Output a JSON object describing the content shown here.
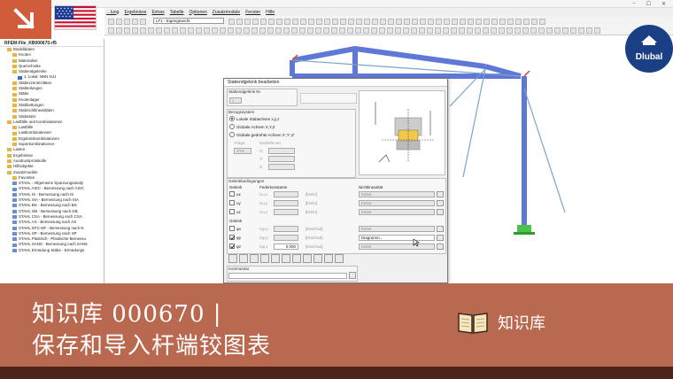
{
  "app": {
    "menu": [
      "…lung",
      "Ergebnisse",
      "Extras",
      "Tabelle",
      "Optionen",
      "Zusatzmodule",
      "Fenster",
      "Hilfe"
    ],
    "loadcase": "LF1 - Eigengewicht"
  },
  "navigator": {
    "root": "RFEM-File_KB000670.rf5",
    "items": [
      {
        "label": "Modelldaten",
        "indent": 1,
        "icon": "folder"
      },
      {
        "label": "Knoten",
        "indent": 2,
        "icon": "folder"
      },
      {
        "label": "Materialien",
        "indent": 2,
        "icon": "folder"
      },
      {
        "label": "Querschnitte",
        "indent": 2,
        "icon": "folder"
      },
      {
        "label": "Stabendgelenke",
        "indent": 2,
        "icon": "folder"
      },
      {
        "label": "1: Lokal: NNN NJJ",
        "indent": 3,
        "icon": "item"
      },
      {
        "label": "Stabexzentrizitäten",
        "indent": 2,
        "icon": "folder"
      },
      {
        "label": "Stabteilungen",
        "indent": 2,
        "icon": "folder"
      },
      {
        "label": "Stäbe",
        "indent": 2,
        "icon": "folder"
      },
      {
        "label": "Knotenlager",
        "indent": 2,
        "icon": "folder"
      },
      {
        "label": "Stabbettungen",
        "indent": 2,
        "icon": "folder"
      },
      {
        "label": "Stabnichtlinearitäten",
        "indent": 2,
        "icon": "folder"
      },
      {
        "label": "Stabsätze",
        "indent": 2,
        "icon": "folder"
      },
      {
        "label": "Lastfälle und Kombinationen",
        "indent": 1,
        "icon": "folder"
      },
      {
        "label": "Lastfälle",
        "indent": 2,
        "icon": "folder"
      },
      {
        "label": "Lastkombinationen",
        "indent": 2,
        "icon": "folder"
      },
      {
        "label": "Ergebniskombinationen",
        "indent": 2,
        "icon": "folder"
      },
      {
        "label": "Superkombinationen",
        "indent": 2,
        "icon": "folder"
      },
      {
        "label": "Lasten",
        "indent": 1,
        "icon": "folder"
      },
      {
        "label": "Ergebnisse",
        "indent": 1,
        "icon": "folder"
      },
      {
        "label": "Ausdruckprotokolle",
        "indent": 1,
        "icon": "folder"
      },
      {
        "label": "Hilfsobjekte",
        "indent": 1,
        "icon": "folder"
      },
      {
        "label": "Zusatzmodule",
        "indent": 1,
        "icon": "folder"
      },
      {
        "label": "Favoriten",
        "indent": 2,
        "icon": "folder"
      },
      {
        "label": "STAHL - Allgemeine Spannungsanaly",
        "indent": 2,
        "icon": "sheet"
      },
      {
        "label": "STAHL AISC - Bemessung nach AISC",
        "indent": 2,
        "icon": "sheet"
      },
      {
        "label": "STAHL IS - Bemessung nach IS",
        "indent": 2,
        "icon": "sheet"
      },
      {
        "label": "STAHL SIA - Bemessung nach SIA",
        "indent": 2,
        "icon": "sheet"
      },
      {
        "label": "STAHL BS - Bemessung nach BS",
        "indent": 2,
        "icon": "sheet"
      },
      {
        "label": "STAHL GB - Bemessung nach GB",
        "indent": 2,
        "icon": "sheet"
      },
      {
        "label": "STAHL CSA - Bemessung nach CSA",
        "indent": 2,
        "icon": "sheet"
      },
      {
        "label": "STAHL AS - Bemessung nach AS",
        "indent": 2,
        "icon": "sheet"
      },
      {
        "label": "STAHL NTC-DF - Bemessung nach N",
        "indent": 2,
        "icon": "sheet"
      },
      {
        "label": "STAHL SP - Bemessung nach SP",
        "indent": 2,
        "icon": "sheet"
      },
      {
        "label": "STAHL Plastisch - Plastische Bemessu",
        "indent": 2,
        "icon": "sheet"
      },
      {
        "label": "STAHL SANS - Bemessung nach SANS",
        "indent": 2,
        "icon": "sheet"
      },
      {
        "label": "STAHL Ermüdung Stäbe - Ermüdungs",
        "indent": 2,
        "icon": "sheet"
      }
    ]
  },
  "dialog": {
    "title": "Stabendgelenk bearbeiten",
    "hinge_no_label": "Stabendgelenk Nr.",
    "hinge_no": "1",
    "ref_system_label": "Bezugssystem",
    "ref_options": [
      "Lokale Stabachsen x,y,z",
      "Globale Achsen X,Y,Z",
      "Globale gedrehte Achsen X',Y',Z'"
    ],
    "sequence_label": "Folge:",
    "sequence_value": "XYZ",
    "rotated_label": "Gedreht um",
    "axis_letters": [
      "X:",
      "Y:",
      "Z:"
    ],
    "conditions_label": "Gelenkbedingungen",
    "hinge_col": "Gelenk",
    "spring_col": "Federkonstante",
    "nonlinear_col": "Nichtlinearität",
    "translation_rows": [
      {
        "label": "ux",
        "spring": "Cu,x",
        "unit": "[kN/m]",
        "nl": "Keine"
      },
      {
        "label": "uy",
        "spring": "Cu,y",
        "unit": "[kN/m]",
        "nl": "Keine"
      },
      {
        "label": "uz",
        "spring": "Cu,z",
        "unit": "[kN/m]",
        "nl": "Keine"
      }
    ],
    "rotation_label": "Gelenk",
    "rotation_rows": [
      {
        "label": "φx",
        "spring": "Cφ,x",
        "unit": "[kNm/rad]",
        "nl": "Keine",
        "value": ""
      },
      {
        "label": "φy",
        "spring": "Cφ,y",
        "unit": "[kNm/rad]",
        "nl": "Diagramm...",
        "value": ""
      },
      {
        "label": "φz",
        "spring": "Cφ,z",
        "unit": "[kNm/rad]",
        "nl": "Keine",
        "value": "0.000"
      }
    ],
    "comment_label": "Kommentar"
  },
  "footer": {
    "title_line1": "知识库 000670 |",
    "title_line2": "保存和导入杆端铰图表",
    "kb_label": "知识库"
  },
  "brand": {
    "name": "Dlubal"
  },
  "colors": {
    "accent": "#b8694f",
    "badge": "#d05c3c",
    "frame": "#5f78d6",
    "dark": "#4e2318"
  }
}
